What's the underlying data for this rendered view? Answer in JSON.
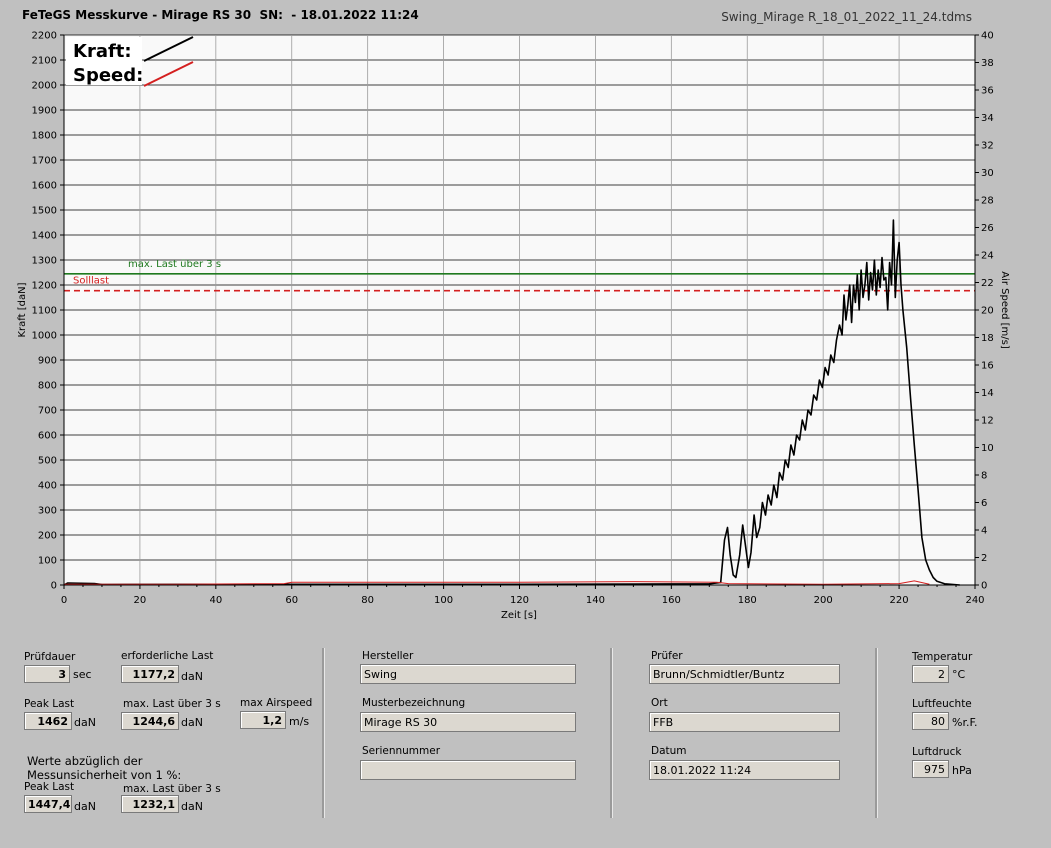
{
  "header": {
    "title": "FeTeGS Messkurve - Mirage RS 30  SN:  - 18.01.2022 11:24",
    "file": "Swing_Mirage R_18_01_2022_11_24.tdms"
  },
  "legend": {
    "kraft": "Kraft:",
    "speed": "Speed:"
  },
  "chart_data": {
    "type": "line",
    "xlabel": "Zeit [s]",
    "ylabel": "Kraft [daN]",
    "y2label": "Air Speed [m/s]",
    "xlim": [
      0,
      240
    ],
    "ylim": [
      0,
      2200
    ],
    "y2lim": [
      0,
      40
    ],
    "xticks": [
      0,
      20,
      40,
      60,
      80,
      100,
      120,
      140,
      160,
      180,
      200,
      220,
      240
    ],
    "yticks": [
      0,
      100,
      200,
      300,
      400,
      500,
      600,
      700,
      800,
      900,
      1000,
      1100,
      1200,
      1300,
      1400,
      1500,
      1600,
      1700,
      1800,
      1900,
      2000,
      2100,
      2200
    ],
    "y2ticks": [
      0,
      2,
      4,
      6,
      8,
      10,
      12,
      14,
      16,
      18,
      20,
      22,
      24,
      26,
      28,
      30,
      32,
      34,
      36,
      38,
      40
    ],
    "grid": true,
    "reference_lines": [
      {
        "label": "max. Last über  3 s",
        "value": 1244.6,
        "color": "#1f7a1f",
        "style": "solid"
      },
      {
        "label": "Solllast",
        "value": 1177.2,
        "color": "#d42020",
        "style": "dashed"
      }
    ],
    "series": [
      {
        "name": "Kraft",
        "color": "#000000",
        "points": [
          [
            0,
            0
          ],
          [
            1,
            8
          ],
          [
            8,
            6
          ],
          [
            10,
            2
          ],
          [
            60,
            3
          ],
          [
            120,
            3
          ],
          [
            170,
            5
          ],
          [
            173,
            10
          ],
          [
            174,
            180
          ],
          [
            174.8,
            230
          ],
          [
            175.5,
            120
          ],
          [
            176.3,
            40
          ],
          [
            177,
            30
          ],
          [
            178,
            120
          ],
          [
            178.8,
            240
          ],
          [
            179.5,
            160
          ],
          [
            180.3,
            70
          ],
          [
            181,
            130
          ],
          [
            181.8,
            280
          ],
          [
            182.5,
            190
          ],
          [
            183.3,
            230
          ],
          [
            184,
            330
          ],
          [
            184.8,
            280
          ],
          [
            185.5,
            360
          ],
          [
            186.3,
            320
          ],
          [
            187,
            400
          ],
          [
            187.8,
            350
          ],
          [
            188.5,
            450
          ],
          [
            189.3,
            420
          ],
          [
            190,
            500
          ],
          [
            190.8,
            470
          ],
          [
            191.5,
            560
          ],
          [
            192.3,
            520
          ],
          [
            193,
            600
          ],
          [
            193.8,
            580
          ],
          [
            194.5,
            660
          ],
          [
            195.3,
            620
          ],
          [
            196,
            700
          ],
          [
            196.8,
            680
          ],
          [
            197.5,
            760
          ],
          [
            198.3,
            740
          ],
          [
            199,
            820
          ],
          [
            199.8,
            790
          ],
          [
            200.5,
            870
          ],
          [
            201.3,
            840
          ],
          [
            202,
            920
          ],
          [
            202.8,
            890
          ],
          [
            203.5,
            980
          ],
          [
            204.3,
            1040
          ],
          [
            205,
            1000
          ],
          [
            205.5,
            1160
          ],
          [
            206,
            1060
          ],
          [
            206.5,
            1120
          ],
          [
            207,
            1200
          ],
          [
            207.5,
            1050
          ],
          [
            208,
            1200
          ],
          [
            208.5,
            1130
          ],
          [
            209,
            1240
          ],
          [
            209.5,
            1100
          ],
          [
            210,
            1260
          ],
          [
            210.5,
            1150
          ],
          [
            211,
            1200
          ],
          [
            211.5,
            1290
          ],
          [
            212,
            1140
          ],
          [
            212.5,
            1250
          ],
          [
            213,
            1180
          ],
          [
            213.5,
            1300
          ],
          [
            214,
            1160
          ],
          [
            214.5,
            1260
          ],
          [
            215,
            1190
          ],
          [
            215.5,
            1310
          ],
          [
            216,
            1220
          ],
          [
            216.5,
            1230
          ],
          [
            217,
            1100
          ],
          [
            217.5,
            1290
          ],
          [
            218,
            1200
          ],
          [
            218.5,
            1460
          ],
          [
            219,
            1150
          ],
          [
            219.5,
            1300
          ],
          [
            220,
            1370
          ],
          [
            220.5,
            1200
          ],
          [
            221,
            1100
          ],
          [
            222,
            950
          ],
          [
            223,
            750
          ],
          [
            224,
            560
          ],
          [
            225,
            380
          ],
          [
            226,
            190
          ],
          [
            227,
            100
          ],
          [
            228,
            60
          ],
          [
            229,
            30
          ],
          [
            230,
            15
          ],
          [
            232,
            5
          ],
          [
            236,
            0
          ]
        ]
      },
      {
        "name": "Speed",
        "color": "#d42020",
        "points": [
          [
            0,
            0.05
          ],
          [
            30,
            0.05
          ],
          [
            58,
            0.1
          ],
          [
            60,
            0.2
          ],
          [
            90,
            0.2
          ],
          [
            120,
            0.2
          ],
          [
            150,
            0.25
          ],
          [
            172,
            0.2
          ],
          [
            175,
            0.1
          ],
          [
            200,
            0.05
          ],
          [
            220,
            0.1
          ],
          [
            224,
            0.3
          ],
          [
            228,
            0.05
          ]
        ]
      }
    ]
  },
  "panel1": {
    "pruefdauer": {
      "label": "Prüfdauer",
      "value": "3",
      "unit": "sec"
    },
    "erforderliche_last": {
      "label": "erforderliche Last",
      "value": "1177,2",
      "unit": "daN"
    },
    "peak_last": {
      "label": "Peak Last",
      "value": "1462",
      "unit": "daN"
    },
    "max_last_3s": {
      "label": "max. Last über  3 s",
      "value": "1244,6",
      "unit": "daN"
    },
    "max_airspeed": {
      "label": "max Airspeed",
      "value": "1,2",
      "unit": "m/s"
    },
    "werte_note_1": "Werte abzüglich der",
    "werte_note_2": "Messunsicherheit von 1  %:",
    "peak_last_corr": {
      "label": "Peak Last",
      "value": "1447,4",
      "unit": "daN"
    },
    "max_last_3s_corr": {
      "label": "max. Last über  3 s",
      "value": "1232,1",
      "unit": "daN"
    }
  },
  "panel2": {
    "hersteller": {
      "label": "Hersteller",
      "value": "Swing"
    },
    "musterbezeichnung": {
      "label": "Musterbezeichnung",
      "value": "Mirage RS 30"
    },
    "seriennummer": {
      "label": "Seriennummer",
      "value": ""
    }
  },
  "panel3": {
    "pruefer": {
      "label": "Prüfer",
      "value": "Brunn/Schmidtler/Buntz"
    },
    "ort": {
      "label": "Ort",
      "value": "FFB"
    },
    "datum": {
      "label": "Datum",
      "value": "18.01.2022 11:24"
    }
  },
  "panel4": {
    "temperatur": {
      "label": "Temperatur",
      "value": "2",
      "unit": "°C"
    },
    "luftfeuchte": {
      "label": "Luftfeuchte",
      "value": "80",
      "unit": "%r.F."
    },
    "luftdruck": {
      "label": "Luftdruck",
      "value": "975",
      "unit": "hPa"
    }
  }
}
